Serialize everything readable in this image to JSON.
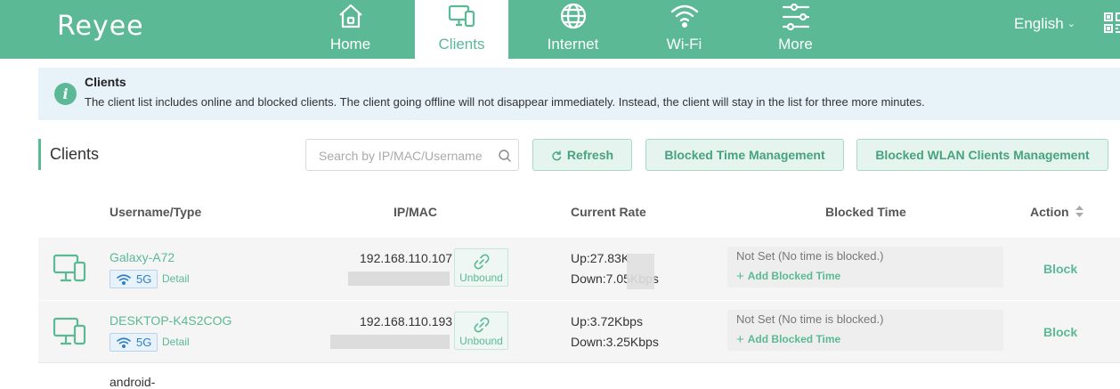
{
  "app": {
    "logo": "Reyee"
  },
  "nav": {
    "tabs": [
      {
        "label": "Home",
        "icon": "home-icon",
        "active": false
      },
      {
        "label": "Clients",
        "icon": "clients-icon",
        "active": true
      },
      {
        "label": "Internet",
        "icon": "globe-icon",
        "active": false
      },
      {
        "label": "Wi-Fi",
        "icon": "wifi-icon",
        "active": false
      },
      {
        "label": "More",
        "icon": "more-icon",
        "active": false
      }
    ],
    "language": "English",
    "qr_icon": "qr-code-icon"
  },
  "banner": {
    "title": "Clients",
    "text": "The client list includes online and blocked clients. The client going offline will not disappear immediately. Instead, the client will stay in the list for three more minutes."
  },
  "section": {
    "title": "Clients",
    "search_placeholder": "Search by IP/MAC/Username",
    "refresh_label": "Refresh",
    "blocked_time_mgmt_label": "Blocked Time Management",
    "blocked_wlan_mgmt_label": "Blocked WLAN Clients Management"
  },
  "table": {
    "headers": [
      "Username/Type",
      "IP/MAC",
      "Current Rate",
      "Blocked Time",
      "Action"
    ],
    "rows": [
      {
        "name": "Galaxy-A72",
        "band": "5G",
        "detail": "Detail",
        "ip": "192.168.110.107",
        "bind": "Unbound",
        "up": "Up:27.83K",
        "down": "Down:7.05Kbps",
        "blocked_status": "Not Set (No time is blocked.)",
        "add_blocked": "Add Blocked Time",
        "action": "Block"
      },
      {
        "name": "DESKTOP-K4S2COG",
        "band": "5G",
        "detail": "Detail",
        "ip": "192.168.110.193",
        "bind": "Unbound",
        "up": "Up:3.72Kbps",
        "down": "Down:3.25Kbps",
        "blocked_status": "Not Set (No time is blocked.)",
        "add_blocked": "Add Blocked Time",
        "action": "Block"
      }
    ],
    "partial_next_row": "android-"
  },
  "colors": {
    "brand": "#5bb995",
    "banner_bg": "#e7f2f9",
    "band_blue": "#2f7fc5"
  }
}
